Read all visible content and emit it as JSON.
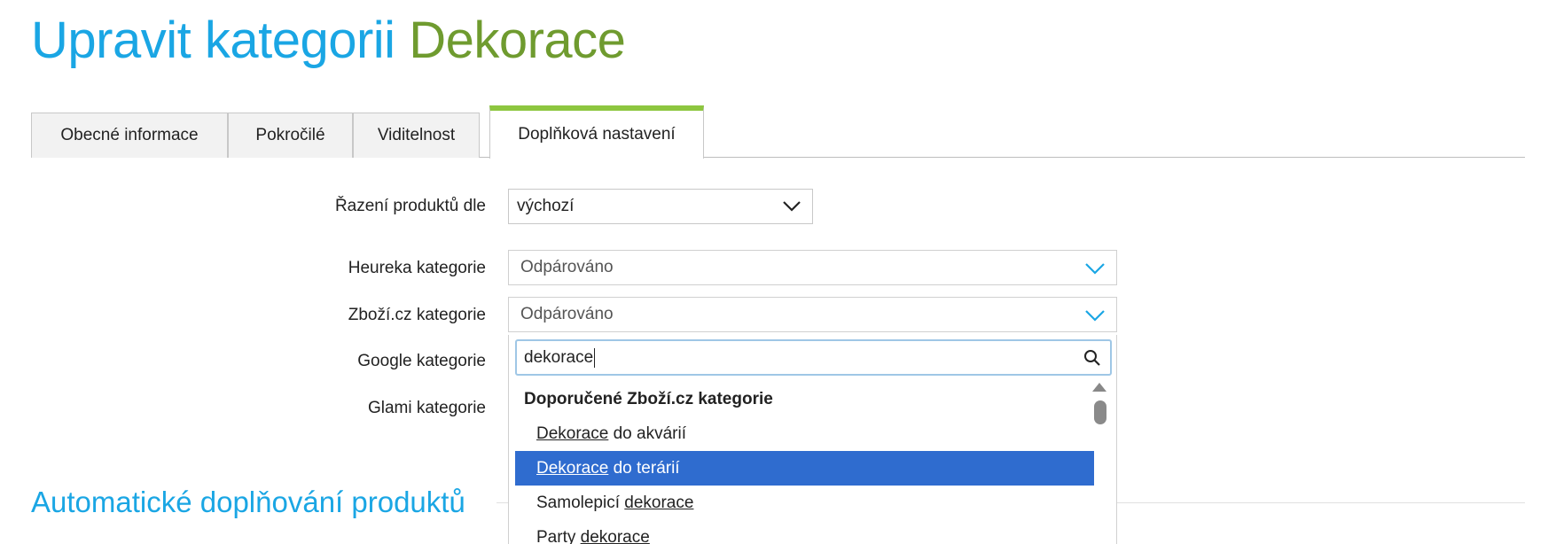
{
  "page": {
    "title_prefix": "Upravit kategorii",
    "title_category": "Dekorace"
  },
  "tabs": [
    {
      "label": "Obecné informace"
    },
    {
      "label": "Pokročilé"
    },
    {
      "label": "Viditelnost"
    },
    {
      "label": "Doplňková nastavení",
      "active": true
    }
  ],
  "form": {
    "sort": {
      "label": "Řazení produktů dle",
      "value": "výchozí"
    },
    "heureka": {
      "label": "Heureka kategorie",
      "value": "Odpárováno"
    },
    "zbozi": {
      "label": "Zboží.cz kategorie",
      "value": "Odpárováno"
    },
    "google": {
      "label": "Google kategorie"
    },
    "glami": {
      "label": "Glami kategorie"
    }
  },
  "dropdown": {
    "search_value": "dekorace",
    "group_title": "Doporučené Zboží.cz kategorie",
    "options": [
      {
        "match": "Dekorace",
        "rest": " do akvárií"
      },
      {
        "match": "Dekorace",
        "rest": " do terárií",
        "highlighted": true
      },
      {
        "pre": "Samolepicí ",
        "match": "dekorace"
      },
      {
        "pre": "Party ",
        "match": "dekorace"
      }
    ]
  },
  "section": {
    "title": "Automatické doplňování produktů"
  },
  "colors": {
    "title_blue": "#1aa6e4",
    "title_green": "#6f9b2f",
    "tab_active_accent": "#8dc63f",
    "option_highlight": "#2f6ccf",
    "chevron_blue": "#1aa6e4"
  }
}
